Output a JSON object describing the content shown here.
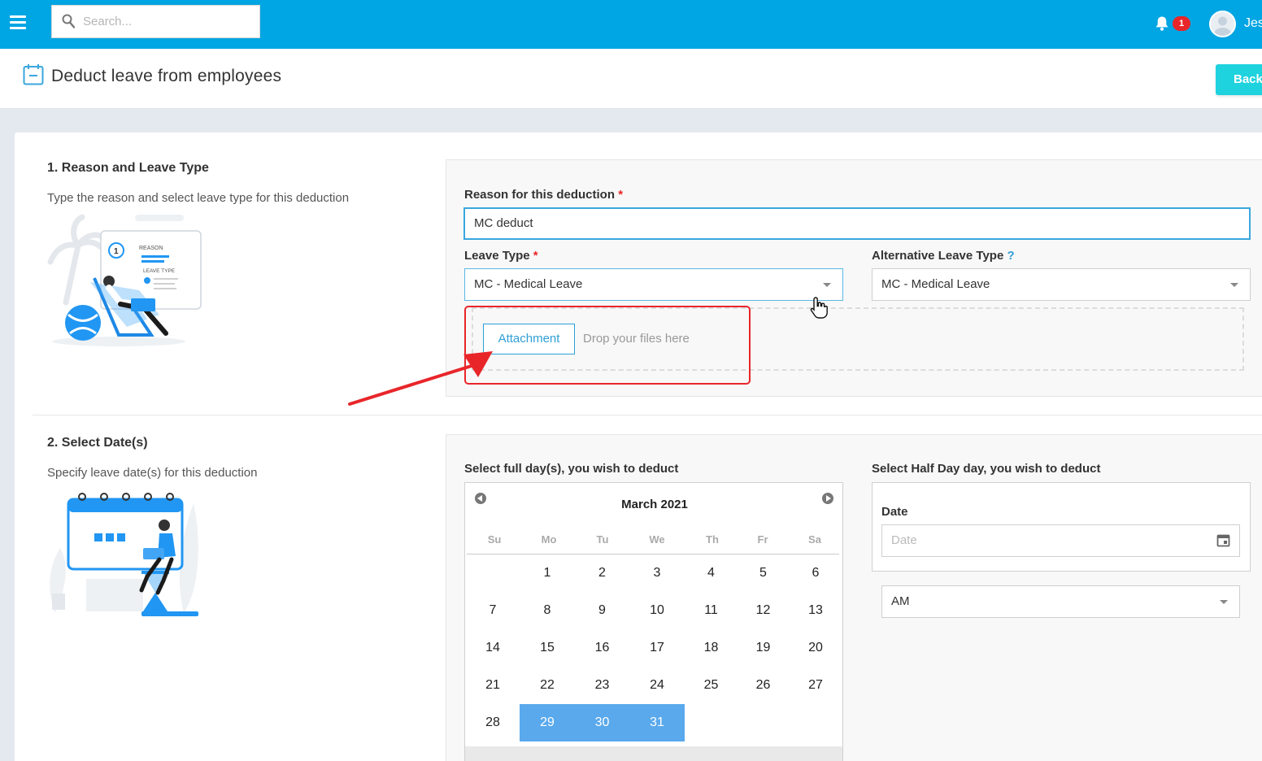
{
  "topbar": {
    "search_placeholder": "Search...",
    "notification_count": "1",
    "user_name": "Jes"
  },
  "page": {
    "title": "Deduct leave from employees",
    "back_label": "Back"
  },
  "section1": {
    "title": "1. Reason and Leave Type",
    "description": "Type the reason and select leave type for this deduction",
    "illustration_text_1": "REASON",
    "illustration_text_2": "LEAVE TYPE",
    "illustration_step": "1",
    "reason_label": "Reason for this deduction",
    "required_mark": "*",
    "reason_value": "MC deduct",
    "leave_type_label": "Leave Type",
    "leave_type_value": "MC - Medical Leave",
    "alt_leave_type_label": "Alternative Leave Type",
    "help_mark": "?",
    "alt_leave_type_value": "MC - Medical Leave",
    "attachment_label": "Attachment",
    "drop_text": "Drop your files here"
  },
  "section2": {
    "title": "2. Select Date(s)",
    "description": "Specify leave date(s) for this deduction",
    "full_day_label": "Select full day(s), you wish to deduct",
    "half_day_label": "Select Half Day day, you wish to deduct",
    "calendar": {
      "month": "March 2021",
      "weekdays": [
        "Su",
        "Mo",
        "Tu",
        "We",
        "Th",
        "Fr",
        "Sa"
      ],
      "weeks": [
        [
          "",
          "1",
          "2",
          "3",
          "4",
          "5",
          "6"
        ],
        [
          "7",
          "8",
          "9",
          "10",
          "11",
          "12",
          "13"
        ],
        [
          "14",
          "15",
          "16",
          "17",
          "18",
          "19",
          "20"
        ],
        [
          "21",
          "22",
          "23",
          "24",
          "25",
          "26",
          "27"
        ],
        [
          "28",
          "29",
          "30",
          "31",
          "",
          "",
          ""
        ]
      ],
      "selected": [
        "29",
        "30",
        "31"
      ]
    },
    "date_label": "Date",
    "date_placeholder": "Date",
    "period_value": "AM"
  },
  "colors": {
    "topbar": "#00a5e3",
    "accent": "#2f9fd6",
    "back_button": "#1ed2de",
    "selected_day": "#5aa9ec",
    "annotation": "#e8262a"
  }
}
